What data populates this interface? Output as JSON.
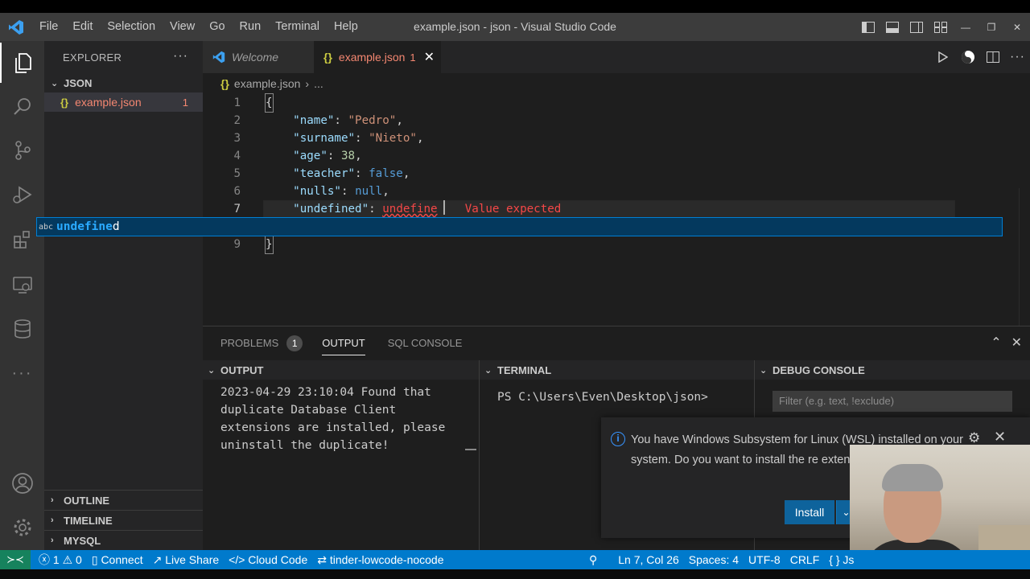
{
  "window": {
    "title": "example.json - json - Visual Studio Code",
    "menus": [
      "File",
      "Edit",
      "Selection",
      "View",
      "Go",
      "Run",
      "Terminal",
      "Help"
    ]
  },
  "sidebar": {
    "header": "EXPLORER",
    "more": "···",
    "folder": "JSON",
    "file": {
      "name": "example.json",
      "problems": "1"
    },
    "sections": [
      "OUTLINE",
      "TIMELINE",
      "MYSQL"
    ]
  },
  "tabs": [
    {
      "label": "Welcome",
      "active": false
    },
    {
      "label": "example.json",
      "badge": "1",
      "active": true
    }
  ],
  "breadcrumb": {
    "file": "example.json",
    "rest": "..."
  },
  "editor": {
    "lines": [
      {
        "num": "1",
        "text": "{"
      },
      {
        "num": "2",
        "key": "\"name\"",
        "value": "\"Pedro\"",
        "vtype": "s"
      },
      {
        "num": "3",
        "key": "\"surname\"",
        "value": "\"Nieto\"",
        "vtype": "s"
      },
      {
        "num": "4",
        "key": "\"age\"",
        "value": "38",
        "vtype": "n"
      },
      {
        "num": "5",
        "key": "\"teacher\"",
        "value": "false",
        "vtype": "b"
      },
      {
        "num": "6",
        "key": "\"nulls\"",
        "value": "null",
        "vtype": "b"
      },
      {
        "num": "7",
        "key": "\"undefined\"",
        "value": "undefine"
      },
      {
        "num": "9",
        "text": "}"
      }
    ],
    "error_message": "Value expected"
  },
  "suggest": {
    "kind": "abc",
    "match": "undefine",
    "rest": "d"
  },
  "panel": {
    "tabs": [
      {
        "label": "PROBLEMS",
        "badge": "1"
      },
      {
        "label": "OUTPUT"
      },
      {
        "label": "SQL CONSOLE"
      }
    ],
    "output": {
      "title": "OUTPUT",
      "text": "2023-04-29 23:10:04 Found that duplicate Database Client extensions are installed, please uninstall the duplicate!"
    },
    "terminal": {
      "title": "TERMINAL",
      "prompt": "PS C:\\Users\\Even\\Desktop\\json>"
    },
    "debug": {
      "title": "DEBUG CONSOLE",
      "filter_placeholder": "Filter (e.g. text, !exclude)"
    }
  },
  "notification": {
    "message": "You have Windows Subsystem for Linux (WSL) installed on your system. Do you want to install the re extensions for it?",
    "install_label": "Install"
  },
  "status": {
    "errors": "1",
    "warnings": "0",
    "items_left": [
      "Connect",
      "Live Share",
      "Cloud Code",
      "tinder-lowcode-nocode"
    ],
    "position": "Ln 7, Col 26",
    "spaces": "Spaces: 4",
    "encoding": "UTF-8",
    "eol": "CRLF",
    "language": "{ } Js"
  },
  "colors": {
    "accent": "#007acc",
    "error": "#f44747",
    "json_key": "#9cdcfe",
    "json_string": "#ce9178"
  }
}
